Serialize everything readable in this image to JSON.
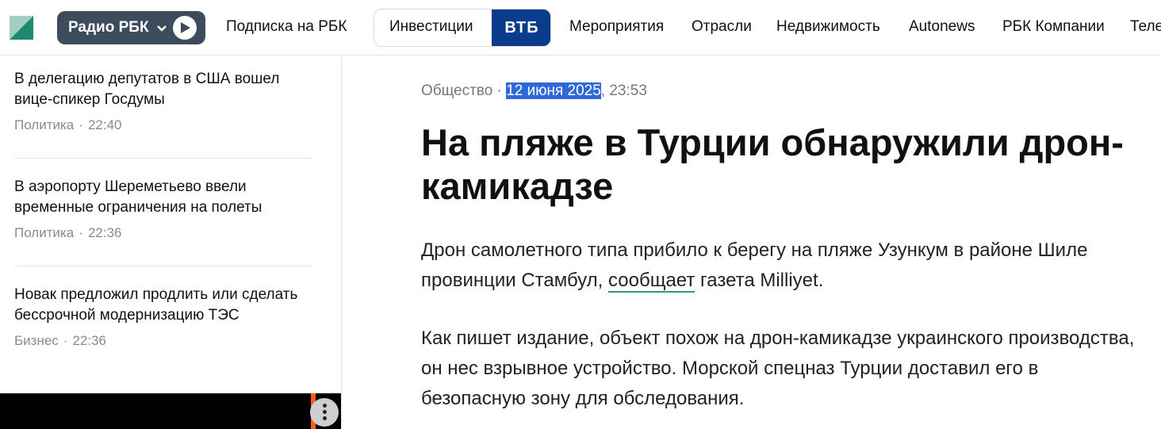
{
  "nav": {
    "radio_label": "Радио РБК",
    "links": [
      "Подписка на РБК",
      "Мероприятия",
      "Отрасли",
      "Недвижимость",
      "Autonews",
      "РБК Компании",
      "Теле"
    ],
    "invest_label": "Инвестиции",
    "vtb_label": "ВТБ"
  },
  "sidebar": {
    "items": [
      {
        "title": "В делегацию депутатов в США вошел вице-спикер Госдумы",
        "category": "Политика",
        "time": "22:40"
      },
      {
        "title": "В аэропорту Шереметьево ввели временные ограничения на полеты",
        "category": "Политика",
        "time": "22:36"
      },
      {
        "title": "Новак предложил продлить или сделать бессрочной модернизацию ТЭС",
        "category": "Бизнес",
        "time": "22:36"
      }
    ]
  },
  "article": {
    "category": "Общество",
    "separator": " · ",
    "date": "12 июня 2025",
    "time": ", 23:53",
    "headline": "На пляже в Турции обнаружили дрон-камикадзе",
    "p1_before": "Дрон самолетного типа прибило к берегу на пляже Узункум в районе Шиле провинции Стамбул, ",
    "p1_link": "сообщает",
    "p1_after": " газета Milliyet.",
    "p2": "Как пишет издание, объект похож на дрон-камикадзе украинского производства, он нес взрывное устройство. Морской спецназ Турции доставил его в безопасную зону для обследования."
  },
  "colors": {
    "radio_bg": "#3d4c5c",
    "vtb_bg": "#0a3b8c",
    "selection": "#2f69d8",
    "link_underline": "#2a9d6a"
  }
}
